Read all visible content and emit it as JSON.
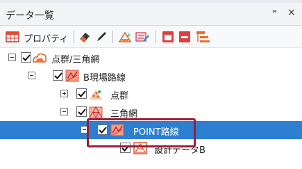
{
  "panel": {
    "title": "データ一覧",
    "pin_glyph": "ꟸ",
    "close_glyph": "×"
  },
  "toolbar": {
    "properties_label": "プロパティ",
    "icons": [
      "grid-table-icon",
      "eraser-icon",
      "pen-icon",
      "point-add-icon",
      "point-edit-icon",
      "window-icon",
      "window-minimize-icon",
      "hierarchy-icon"
    ]
  },
  "tree": {
    "items": [
      {
        "label": "点群/三角網",
        "expanded": true,
        "checked": true,
        "icon": "cloud-point-icon"
      },
      {
        "label": "B現場路線",
        "expanded": true,
        "checked": true,
        "icon": "road-icon"
      },
      {
        "label": "点群",
        "expanded": false,
        "checked": true,
        "icon": "point-cloud-icon"
      },
      {
        "label": "三角網",
        "expanded": true,
        "checked": true,
        "icon": "triangle-mesh-icon"
      },
      {
        "label": "POINT路線",
        "expanded": true,
        "checked": true,
        "selected": true,
        "icon": "road-icon"
      },
      {
        "label": "設計データB",
        "checked": true,
        "icon": "design-data-icon"
      }
    ]
  },
  "colors": {
    "selection": "#2d7fd1",
    "highlight_border": "#9a1d3a"
  }
}
